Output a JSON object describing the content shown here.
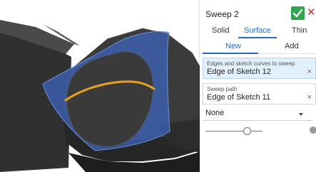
{
  "panel": {
    "title": "Sweep 2",
    "types": [
      "Solid",
      "Surface",
      "Thin"
    ],
    "selected_type": "Surface",
    "modes": [
      "New",
      "Add"
    ],
    "selected_mode": "New",
    "fields": {
      "profiles": {
        "label": "Edges and sketch curves to sweep",
        "value": "Edge of Sketch 12",
        "clear": "×"
      },
      "path": {
        "label": "Sweep path",
        "value": "Edge of Sketch 11",
        "clear": "×"
      }
    },
    "profile_control": "None",
    "slider_level": 0.72
  },
  "icons": [
    "check-icon",
    "close-icon",
    "chevron-down-icon",
    "help-icon"
  ],
  "colors": {
    "accent": "#2b67c6",
    "confirm": "#2ea44f",
    "cancel": "#d9262c",
    "surface": "#3c63b6",
    "path_curve": "#e8a225",
    "model": "#2e2e2e"
  }
}
